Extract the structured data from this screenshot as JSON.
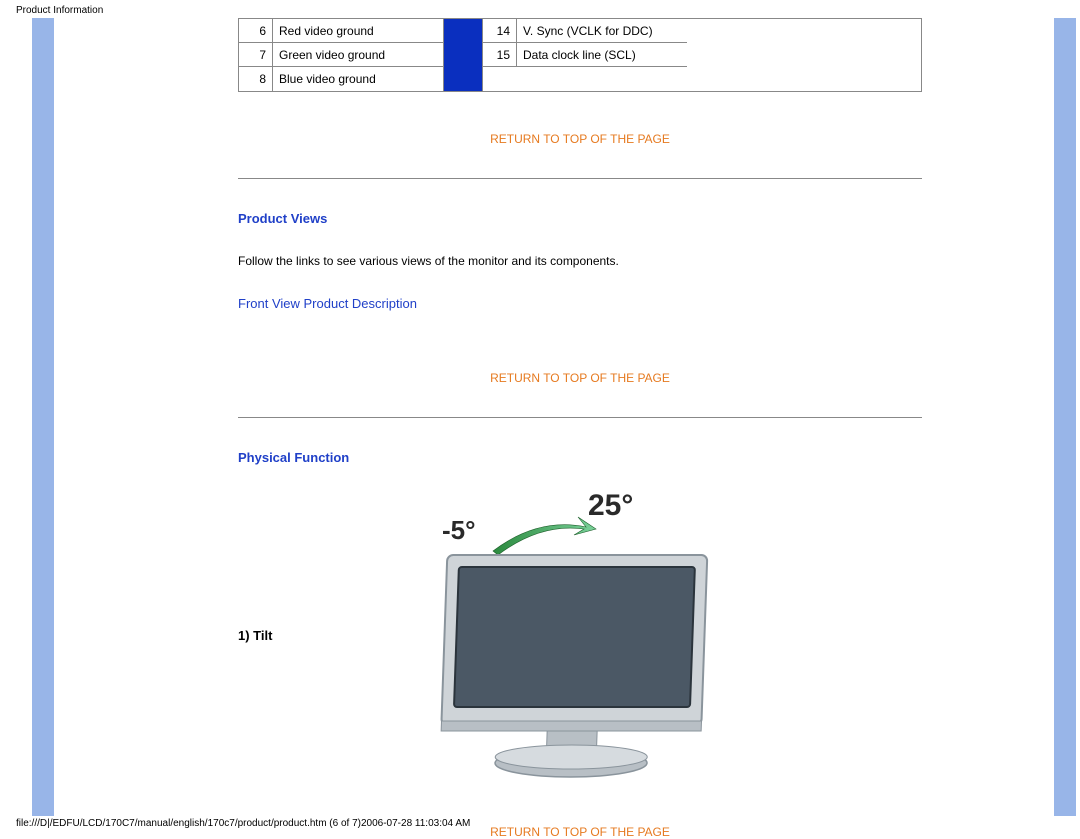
{
  "header": "Product Information",
  "pin_table": {
    "left": [
      {
        "num": "6",
        "desc": "Red video ground"
      },
      {
        "num": "7",
        "desc": "Green video ground"
      },
      {
        "num": "8",
        "desc": "Blue video ground"
      }
    ],
    "right": [
      {
        "num": "14",
        "desc": "V. Sync (VCLK for DDC)"
      },
      {
        "num": "15",
        "desc": "Data clock line (SCL)"
      }
    ]
  },
  "return_link": "RETURN TO TOP OF THE PAGE",
  "sections": {
    "product_views": {
      "heading": "Product Views",
      "body": "Follow the links to see various views of the monitor and its components.",
      "link": "Front View Product Description"
    },
    "physical_function": {
      "heading": "Physical Function",
      "tilt_label": "1) Tilt",
      "angle_neg": "-5°",
      "angle_pos": "25°"
    }
  },
  "footer": "file:///D|/EDFU/LCD/170C7/manual/english/170c7/product/product.htm (6 of 7)2006-07-28 11:03:04 AM"
}
